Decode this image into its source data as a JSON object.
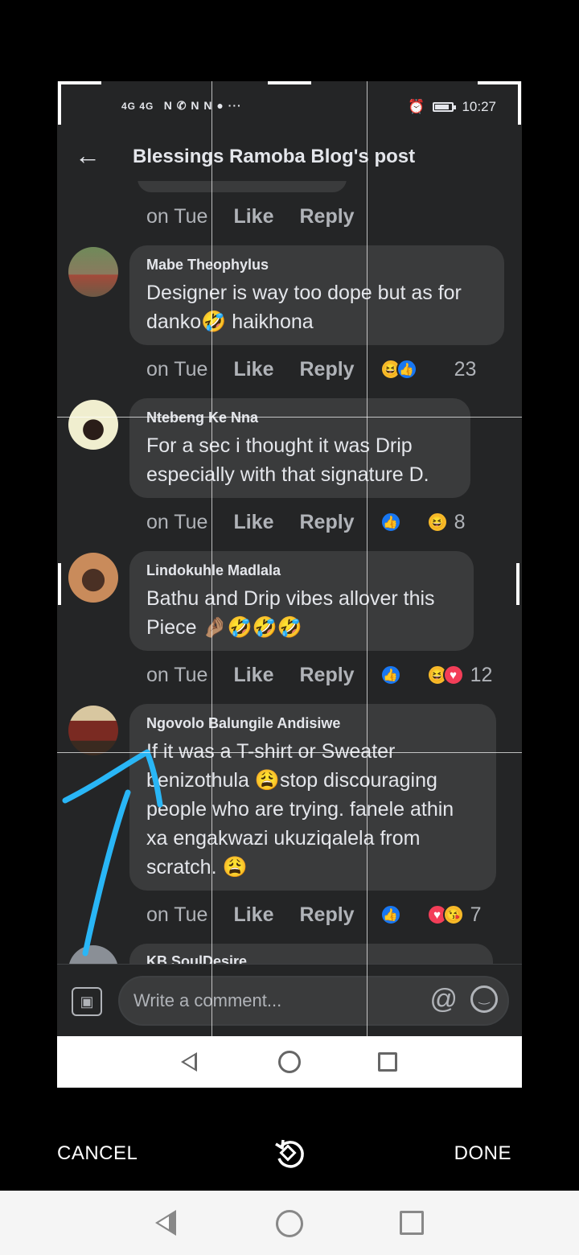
{
  "status_bar": {
    "signal": "4G 4G",
    "notifications": "N ✆ N N ● ···",
    "alarm_icon": "alarm-icon",
    "time": "10:27"
  },
  "app_bar": {
    "back_icon": "back-arrow-icon",
    "title": "Blessings Ramoba Blog's post"
  },
  "top_partial_action": {
    "time": "on Tue",
    "like": "Like",
    "reply": "Reply"
  },
  "comments": [
    {
      "name": "Mabe Theophylus",
      "text_lines": [
        "Designer is way too dope but as for",
        "danko🤣 haikhona"
      ],
      "time": "on Tue",
      "like": "Like",
      "reply": "Reply",
      "reactions": [
        "haha",
        "like"
      ],
      "count": "23"
    },
    {
      "name": "Ntebeng Ke Nna",
      "text_lines": [
        "For a sec i thought it was Drip",
        "especially with that signature D."
      ],
      "time": "on Tue",
      "like": "Like",
      "reply": "Reply",
      "reactions": [
        "like",
        "haha"
      ],
      "count": "8"
    },
    {
      "name": "Lindokuhle Madlala",
      "text_lines": [
        "Bathu and Drip vibes allover this",
        "Piece 🤌🏽🤣🤣🤣"
      ],
      "time": "on Tue",
      "like": "Like",
      "reply": "Reply",
      "reactions": [
        "like",
        "haha",
        "love"
      ],
      "count": "12"
    },
    {
      "name": "Ngovolo Balungile Andisiwe",
      "text_lines": [
        "If it was a T-shirt or Sweater",
        "benizothula 😩stop discouraging",
        "people who are trying. fanele athin",
        "xa engakwazi ukuziqalela from",
        "scratch. 😩"
      ],
      "time": "on Tue",
      "like": "Like",
      "reply": "Reply",
      "reactions": [
        "like",
        "love",
        "care"
      ],
      "count": "7"
    },
    {
      "name": "KB SoulDesire"
    }
  ],
  "composer": {
    "photo_icon": "photo-icon",
    "placeholder": "Write a comment...",
    "mention_icon": "at-icon",
    "emoji_icon": "smiley-icon"
  },
  "editor": {
    "cancel": "CANCEL",
    "rotate_icon": "rotate-icon",
    "done": "DONE"
  },
  "annotation": {
    "color": "#29b6f6",
    "icon": "arrow-annotation"
  },
  "colors": {
    "background": "#242526",
    "bubble": "#3a3b3c",
    "text": "#e4e6eb",
    "secondary": "#b0b3b8",
    "like_blue": "#1877f2"
  }
}
